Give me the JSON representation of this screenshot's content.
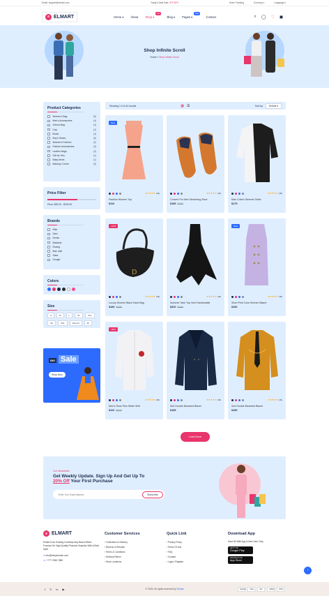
{
  "topbar": {
    "email": "Email: support@elmart.com",
    "deal_label": "Today's Deal Sale",
    "deal_value": "OFF 80%",
    "order_tracking": "Order Tracking",
    "currency": "Currency",
    "language": "Language"
  },
  "header": {
    "logo": "ELMART",
    "nav": [
      {
        "label": "Home",
        "badge": ""
      },
      {
        "label": "About",
        "badge": ""
      },
      {
        "label": "Shop",
        "badge": "Hot"
      },
      {
        "label": "Blog",
        "badge": ""
      },
      {
        "label": "Pages",
        "badge": "New"
      },
      {
        "label": "Contact",
        "badge": ""
      }
    ]
  },
  "hero": {
    "title": "Shop Infinite Scroll",
    "crumb_home": "Home",
    "crumb_sep": "»",
    "crumb_current": "Shop Infinite Scroll"
  },
  "sidebar": {
    "categories_title": "Product Categories",
    "categories": [
      {
        "name": "Women's Bag",
        "count": "(5)"
      },
      {
        "name": "Men's Accessories",
        "count": "(4)"
      },
      {
        "name": "School Bag",
        "count": "(4)"
      },
      {
        "name": "Cap",
        "count": "(2)"
      },
      {
        "name": "Boots",
        "count": "(4)"
      },
      {
        "name": "Boy's Shoes",
        "count": "(6)"
      },
      {
        "name": "Women's Fashion",
        "count": "(2)"
      },
      {
        "name": "Fashion Accessories",
        "count": "(3)"
      },
      {
        "name": "Leather Bags",
        "count": "(2)"
      },
      {
        "name": "Gift for Him",
        "count": "(1)"
      },
      {
        "name": "Baby Items",
        "count": "(1)"
      },
      {
        "name": "Makeup Corner",
        "count": "(3)"
      }
    ],
    "price_title": "Price Filter",
    "price_label": "Price:",
    "price_range": "$39.00 - $150.00",
    "price_fill": 0.62,
    "brands_title": "Brands",
    "brands": [
      "Nike",
      "Zara",
      "Denim",
      "Madame",
      "Roving",
      "Max mall",
      "Sasa",
      "Hunger"
    ],
    "colors_title": "Colors",
    "colors": [
      "#2d6bff",
      "#e8356b",
      "#1c2a4a",
      "#2b2b2b",
      "#ffffff",
      "#ff4d8d"
    ],
    "size_title": "Size",
    "sizes": [
      "S",
      "M",
      "L",
      "XL",
      "XXL",
      "XS",
      "XXL",
      "Size Fit",
      "Fit"
    ],
    "promo": {
      "tag": "BIG",
      "title": "Sale",
      "button": "Shop Now"
    }
  },
  "toolbar": {
    "results": "Showing 1-9 of 44 results",
    "sort_label": "Sort by:",
    "sort_value": "Default"
  },
  "products": [
    {
      "name": "Fashion Women Top",
      "price": "$110",
      "old": "",
      "label": "New",
      "label_color": "#2d6bff",
      "rating": "(49)",
      "item": "dress"
    },
    {
      "name": "Convert For Men Stretching Shoe",
      "price": "$185",
      "old": "$200",
      "label": "",
      "label_color": "",
      "rating": "(49)",
      "item": "shoes"
    },
    {
      "name": "Man Cotton Sleeves Shirts",
      "price": "$175",
      "old": "",
      "label": "",
      "label_color": "",
      "rating": "(49)",
      "item": "shirtbw"
    },
    {
      "name": "Luxury Women Black Hand Bag",
      "price": "$180",
      "old": "$300",
      "label": "-15%",
      "label_color": "#e8356b",
      "rating": "(49)",
      "item": "bag"
    },
    {
      "name": "Summer Tank Top Vest Fashionable",
      "price": "$320",
      "old": "$400",
      "label": "",
      "label_color": "",
      "rating": "(49)",
      "item": "blackdress"
    },
    {
      "name": "Short Pink Color Women Blazer",
      "price": "$150",
      "old": "",
      "label": "New",
      "label_color": "#2d6bff",
      "rating": "(49)",
      "item": "lilac"
    },
    {
      "name": "Men's Rose Plus White Shirt",
      "price": "$110",
      "old": "$200",
      "label": "-30%",
      "label_color": "#e8356b",
      "rating": "(49)",
      "item": "whiteshirt"
    },
    {
      "name": "Suit Double Breasted Blazer",
      "price": "$185",
      "old": "",
      "label": "",
      "label_color": "",
      "rating": "(49)",
      "item": "blazer"
    },
    {
      "name": "Suit Double Breasted Blazer",
      "price": "$185",
      "old": "",
      "label": "",
      "label_color": "",
      "rating": "(49)",
      "item": "goldshirt"
    }
  ],
  "stars": "★★★★★",
  "load_more": "Load More",
  "newsletter": {
    "kicker": "Our Newsletter",
    "line1": "Get Weekly Update. Sign Up And Get Up To",
    "highlight": "20% Off",
    "line2": "Your First Purchase",
    "placeholder": "Enter Your Email Address",
    "button": "Subscribe"
  },
  "footer": {
    "logo": "ELMART",
    "about": "Elmart Is An Exciting Contemporary Brand Which Focuses On High-Quality Products Graphics With A Bold Style",
    "email": "info@elmydomain.com",
    "phone": "+777 2345 7885",
    "services_title": "Customer Services",
    "services": [
      "Collections & Delivery",
      "Returns & Refunds",
      "Terms & Conditions",
      "Delivery Return",
      "Store Locations"
    ],
    "quick_title": "Quick Link",
    "quick": [
      "Privacy Policy",
      "Terms Of Use",
      "FAQ",
      "Contact",
      "Login / Register"
    ],
    "app_title": "Download App",
    "app_text": "Save $3 With App & New User Only",
    "google": "Google Play",
    "apple": "App Store",
    "get_on": "GET IT ON",
    "download_on": "Download on the"
  },
  "bottom": {
    "copyright": "© 2025. All rights reserved by",
    "brand": "Elmart",
    "payments": [
      "PayPal",
      "VISA",
      "MC",
      "AMEX",
      "DISC"
    ]
  }
}
